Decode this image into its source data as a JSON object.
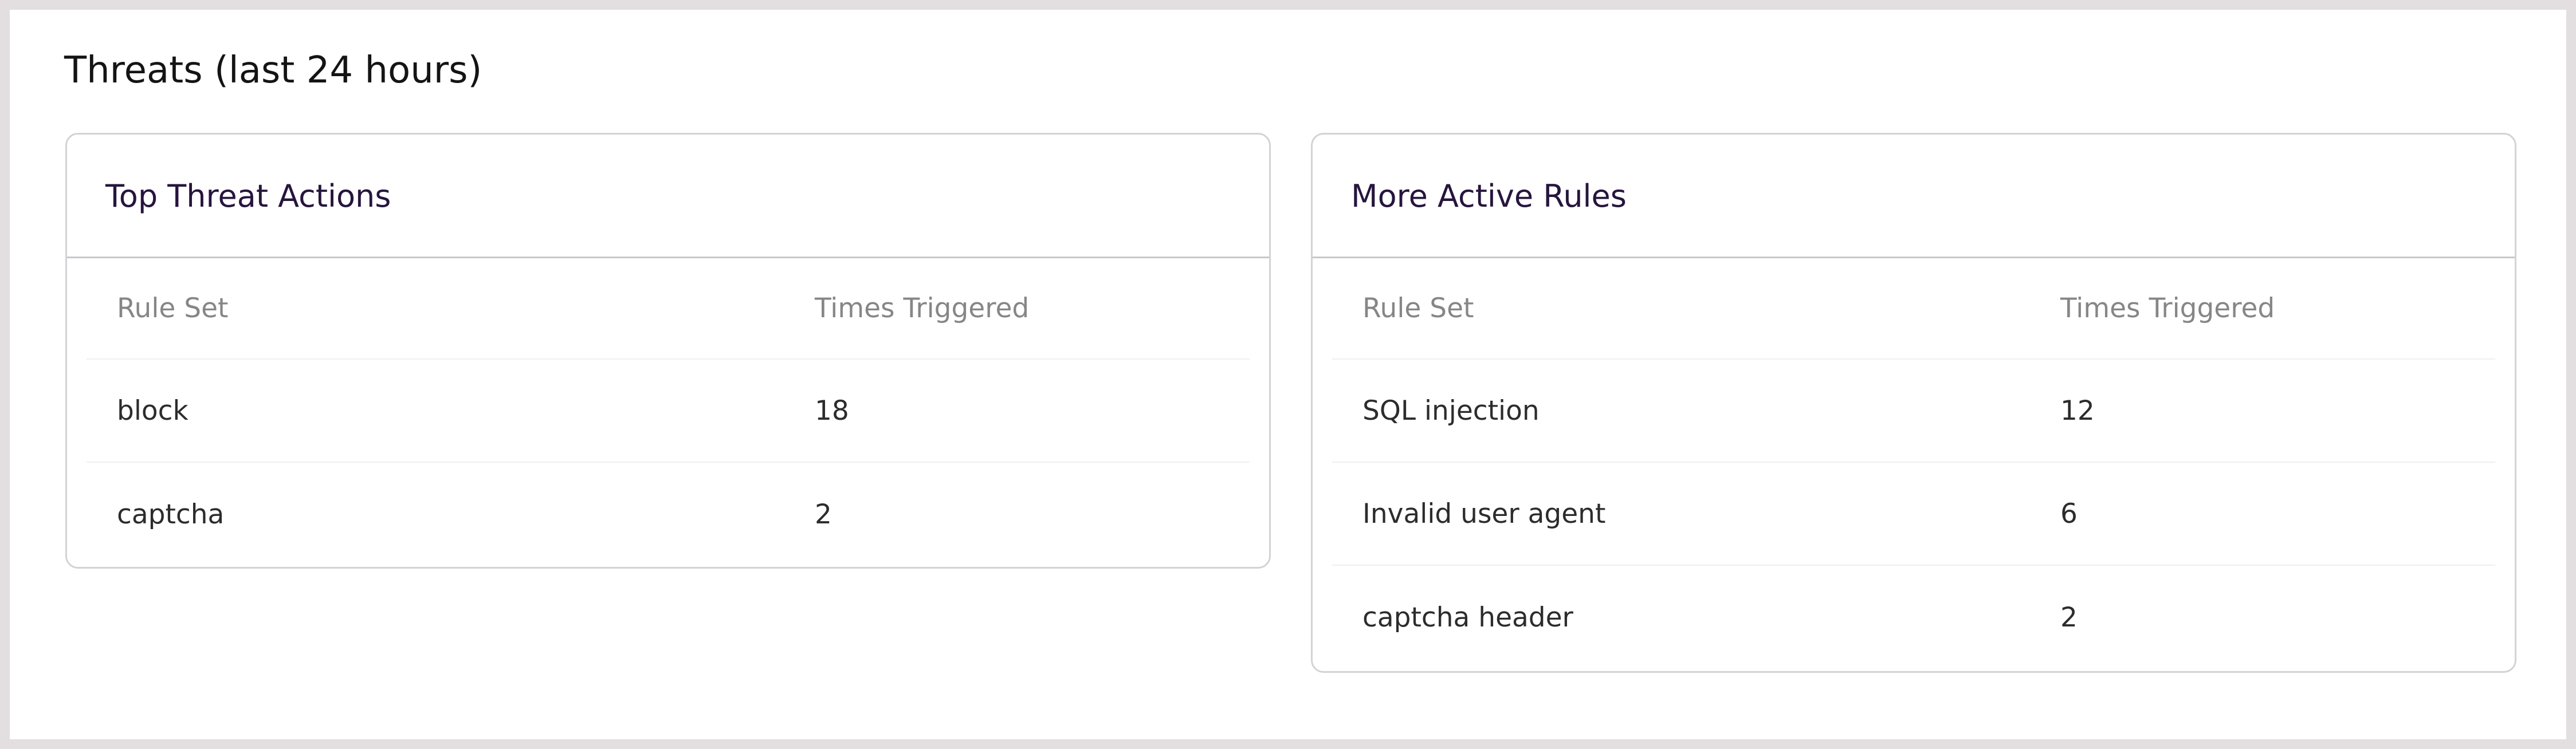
{
  "page": {
    "title": "Threats (last 24 hours)"
  },
  "top_threat_actions": {
    "title": "Top Threat Actions",
    "columns": [
      "Rule Set",
      "Times Triggered"
    ],
    "rows": [
      {
        "rule_set": "block",
        "times_triggered": "18"
      },
      {
        "rule_set": "captcha",
        "times_triggered": "2"
      }
    ]
  },
  "more_active_rules": {
    "title": "More Active Rules",
    "columns": [
      "Rule Set",
      "Times Triggered"
    ],
    "rows": [
      {
        "rule_set": "SQL injection",
        "times_triggered": "12"
      },
      {
        "rule_set": "Invalid user agent",
        "times_triggered": "6"
      },
      {
        "rule_set": "captcha header",
        "times_triggered": "2"
      }
    ]
  },
  "colors": {
    "outer_background": "#e3dfe0",
    "panel_background": "#ffffff",
    "card_border": "#d4d2d6",
    "card_title": "#26153d",
    "header_text": "#868686",
    "cell_text": "#2c2c2c"
  }
}
